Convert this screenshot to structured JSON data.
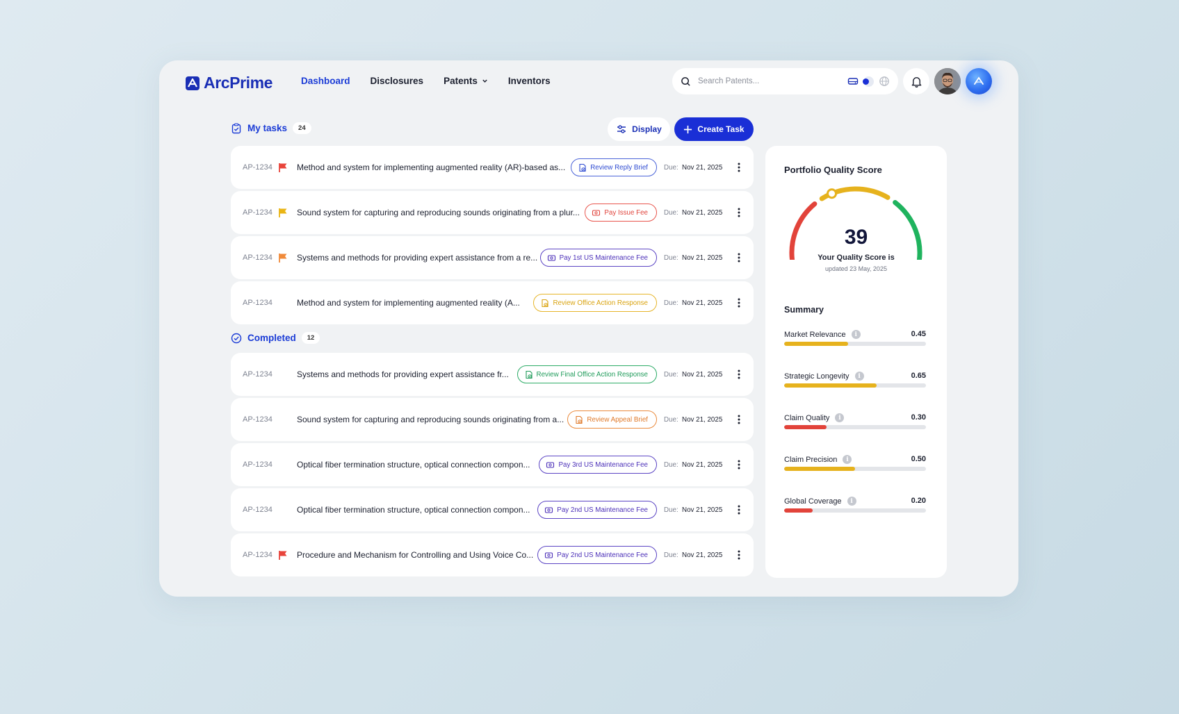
{
  "header": {
    "brand": "ArcPrime",
    "nav": [
      {
        "label": "Dashboard",
        "active": true
      },
      {
        "label": "Disclosures",
        "active": false
      },
      {
        "label": "Patents",
        "active": false,
        "has_dropdown": true
      },
      {
        "label": "Inventors",
        "active": false
      }
    ],
    "search": {
      "placeholder": "Search Patents..."
    }
  },
  "toolbar": {
    "display_label": "Display",
    "create_label": "Create Task"
  },
  "my_tasks": {
    "title": "My tasks",
    "count": "24",
    "items": [
      {
        "id": "AP-1234",
        "flag": "red",
        "title": "Method and system for implementing augmented reality (AR)-based as...",
        "tag": "Review Reply Brief",
        "tag_color": "blue",
        "tag_icon": "document-icon",
        "due_label": "Due:",
        "due_date": "Nov 21, 2025"
      },
      {
        "id": "AP-1234",
        "flag": "yellow",
        "title": "Sound system for capturing and reproducing sounds originating from a plur...",
        "tag": "Pay Issue Fee",
        "tag_color": "red",
        "tag_icon": "money-icon",
        "due_label": "Due:",
        "due_date": "Nov 21, 2025"
      },
      {
        "id": "AP-1234",
        "flag": "orange",
        "title": "Systems and methods for providing expert assistance from a re...",
        "tag": "Pay 1st US Maintenance Fee",
        "tag_color": "purple",
        "tag_icon": "money-icon",
        "due_label": "Due:",
        "due_date": "Nov 21, 2025"
      },
      {
        "id": "AP-1234",
        "flag": "none",
        "title": "Method and system for implementing augmented reality (A...",
        "tag": "Review Office Action Response",
        "tag_color": "yellow",
        "tag_icon": "document-icon",
        "due_label": "Due:",
        "due_date": "Nov 21, 2025"
      }
    ]
  },
  "completed": {
    "title": "Completed",
    "count": "12",
    "items": [
      {
        "id": "AP-1234",
        "flag": "none",
        "title": "Systems and methods for providing expert assistance fr...",
        "tag": "Review Final Office Action Response",
        "tag_color": "green",
        "tag_icon": "document-icon",
        "due_label": "Due:",
        "due_date": "Nov 21, 2025"
      },
      {
        "id": "AP-1234",
        "flag": "none",
        "title": "Sound system for capturing and reproducing sounds originating from a...",
        "tag": "Review Appeal Brief",
        "tag_color": "orange",
        "tag_icon": "document-icon",
        "due_label": "Due:",
        "due_date": "Nov 21, 2025"
      },
      {
        "id": "AP-1234",
        "flag": "none",
        "title": "Optical fiber termination structure, optical connection compon...",
        "tag": "Pay 3rd US Maintenance Fee",
        "tag_color": "purple",
        "tag_icon": "money-icon",
        "due_label": "Due:",
        "due_date": "Nov 21, 2025"
      },
      {
        "id": "AP-1234",
        "flag": "none",
        "title": "Optical fiber termination structure, optical connection compon...",
        "tag": "Pay 2nd US Maintenance Fee",
        "tag_color": "purple",
        "tag_icon": "money-icon",
        "due_label": "Due:",
        "due_date": "Nov 21, 2025"
      },
      {
        "id": "AP-1234",
        "flag": "red",
        "title": "Procedure and Mechanism for Controlling and Using Voice Co...",
        "tag": "Pay 2nd US Maintenance Fee",
        "tag_color": "purple",
        "tag_icon": "money-icon",
        "due_label": "Due:",
        "due_date": "Nov 21, 2025"
      }
    ]
  },
  "quality": {
    "title": "Portfolio Quality Score",
    "score": "39",
    "score_fraction": 0.39,
    "label": "Your Quality Score is",
    "updated": "updated 23 May, 2025",
    "summary_title": "Summary",
    "metrics": [
      {
        "name": "Market Relevance",
        "value": "0.45",
        "fraction": 0.45,
        "color": "#e6b21d"
      },
      {
        "name": "Strategic Longevity",
        "value": "0.65",
        "fraction": 0.65,
        "color": "#e6b21d"
      },
      {
        "name": "Claim Quality",
        "value": "0.30",
        "fraction": 0.3,
        "color": "#e2433a"
      },
      {
        "name": "Claim Precision",
        "value": "0.50",
        "fraction": 0.5,
        "color": "#e6b21d"
      },
      {
        "name": "Global Coverage",
        "value": "0.20",
        "fraction": 0.2,
        "color": "#e2433a"
      }
    ]
  },
  "colors": {
    "accent": "#1a2fd6",
    "flag_red": "#e8443b",
    "flag_yellow": "#eab515",
    "flag_orange": "#f08a3a",
    "gauge_red": "#e2433a",
    "gauge_yellow": "#e6b21d",
    "gauge_green": "#1fb35e"
  }
}
